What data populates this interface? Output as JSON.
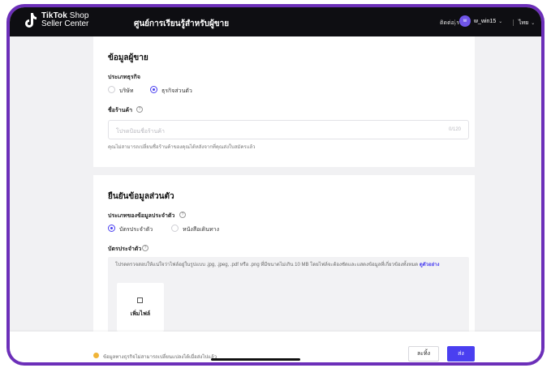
{
  "header": {
    "logo_line1_bold": "TikTok",
    "logo_line1_rest": "Shop",
    "logo_line2": "Seller Center",
    "center_title": "ศูนย์การเรียนรู้สำหรับผู้ขาย",
    "contact": "ติดต่อเรา",
    "avatar_text": "w",
    "username": "w_win15",
    "language": "ไทย"
  },
  "seller_info": {
    "title": "ข้อมูลผู้ขาย",
    "business_type_label": "ประเภทธุรกิจ",
    "options": [
      "บริษัท",
      "ธุรกิจส่วนตัว"
    ],
    "selected": "ธุรกิจส่วนตัว",
    "shop_name_label": "ชื่อร้านค้า",
    "shop_name_placeholder": "โปรดป้อนชื่อร้านค้า",
    "shop_name_counter": "0/120",
    "shop_name_hint": "คุณไม่สามารถเปลี่ยนชื่อร้านค้าของคุณได้หลังจากที่คุณส่งใบสมัครแล้ว"
  },
  "identity": {
    "title": "ยืนยันข้อมูลส่วนตัว",
    "id_type_label": "ประเภทของข้อมูลประจำตัว",
    "options": [
      "บัตรประจำตัว",
      "หนังสือเดินทาง"
    ],
    "selected": "บัตรประจำตัว",
    "id_card_label": "บัตรประจำตัว",
    "upload_instructions": "โปรดตรวจสอบให้แน่ใจว่าไฟล์อยู่ในรูปแบบ .jpg, .jpeg, .pdf หรือ .png ที่มีขนาดไม่เกิน 10 MB โดยไฟล์จะต้องชัดและแสดงข้อมูลที่เกี่ยวข้องทั้งหมด",
    "upload_link": "ดูตัวอย่าง",
    "add_file_label": "เพิ่มไฟล์"
  },
  "footer": {
    "warning": "ข้อมูลทางธุรกิจไม่สามารถเปลี่ยนแปลงได้เมื่อส่งไปแล้ว",
    "save_label": "ละทิ้ง",
    "submit_label": "ส่ง"
  },
  "colors": {
    "accent": "#4a3ff0",
    "frame": "#6c2fb9",
    "warning": "#f0b437"
  }
}
